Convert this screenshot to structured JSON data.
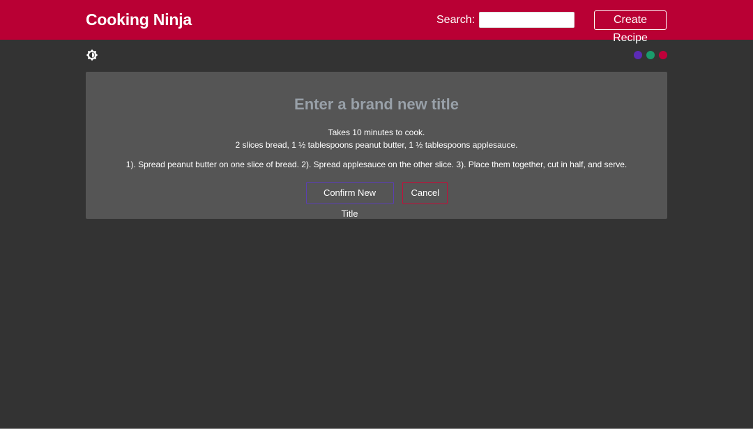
{
  "navbar": {
    "brand": "Cooking Ninja",
    "search_label": "Search:",
    "search_value": "",
    "create_label": "Create Recipe",
    "color": "#b90034"
  },
  "toolbar": {
    "theme_icon": "brightness-toggle-icon",
    "swatches": [
      {
        "name": "purple",
        "color": "#5b2bb5"
      },
      {
        "name": "green",
        "color": "#1a9b6c"
      },
      {
        "name": "crimson",
        "color": "#c0003a"
      }
    ]
  },
  "recipe": {
    "title": "Enter a brand new title",
    "cook_time": "Takes 10 minutes to cook.",
    "ingredients": "2 slices bread, 1 ½ tablespoons peanut butter, 1 ½ tablespoons applesauce.",
    "method": "1). Spread peanut butter on one slice of bread. 2). Spread applesauce on the other slice. 3). Place them together, cut in half, and serve.",
    "confirm_label": "Confirm New Title",
    "cancel_label": "Cancel"
  }
}
